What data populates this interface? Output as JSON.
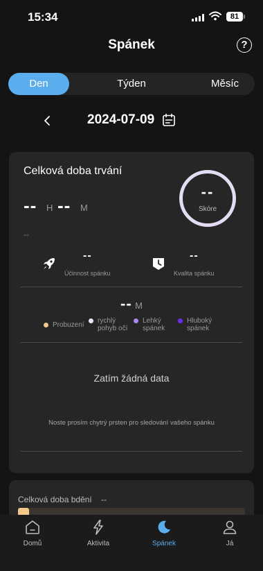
{
  "status_bar": {
    "time": "15:34",
    "battery": "81"
  },
  "header": {
    "title": "Spánek",
    "help_icon": "question-icon"
  },
  "tabs": [
    {
      "label": "Den",
      "active": true
    },
    {
      "label": "Týden",
      "active": false
    },
    {
      "label": "Měsíc",
      "active": false
    }
  ],
  "date": {
    "value": "2024-07-09"
  },
  "duration_card": {
    "title": "Celková doba trvání",
    "hours_value": "--",
    "hours_unit": "H",
    "minutes_value": "--",
    "minutes_unit": "M",
    "sub_value": "--",
    "score": {
      "value": "--",
      "label": "Skóre",
      "ring_color": "#e4dcf3"
    },
    "efficiency": {
      "value": "--",
      "label": "Účinnost spánku",
      "icon": "rocket-icon"
    },
    "quality": {
      "value": "--",
      "label": "Kvalita spánku",
      "icon": "clock-badge-icon"
    },
    "total": {
      "value": "--",
      "unit": "M"
    },
    "legend": [
      {
        "label_1": "Probuzení",
        "label_2": "",
        "color": "#f3c88a"
      },
      {
        "label_1": "rychlý",
        "label_2": "pohyb očí",
        "color": "#ece4fb"
      },
      {
        "label_1": "Lehký",
        "label_2": "spánek",
        "color": "#a98bf0"
      },
      {
        "label_1": "Hluboký",
        "label_2": "spánek",
        "color": "#6e2bf0"
      }
    ],
    "empty_title": "Zatím žádná data",
    "empty_hint": "Noste prosím chytrý prsten pro sledování vašeho spánku"
  },
  "awake_card": {
    "title": "Celková doba bdění",
    "value": "--"
  },
  "nav": [
    {
      "label": "Domů",
      "icon": "home-icon",
      "active": false
    },
    {
      "label": "Aktivita",
      "icon": "lightning-icon",
      "active": false
    },
    {
      "label": "Spánek",
      "icon": "moon-icon",
      "active": true
    },
    {
      "label": "Já",
      "icon": "person-icon",
      "active": false
    }
  ],
  "colors": {
    "accent": "#5aaeee",
    "background": "#141414",
    "card": "#262626"
  }
}
